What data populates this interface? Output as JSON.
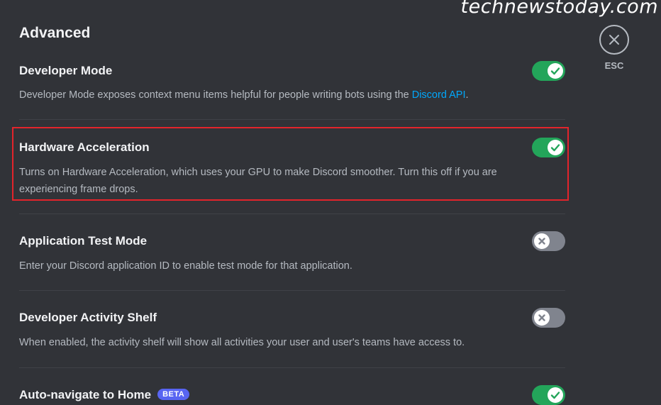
{
  "watermark": "technewstoday.com",
  "page_title": "Advanced",
  "esc": {
    "label": "ESC",
    "icon": "close-icon"
  },
  "settings": [
    {
      "title": "Developer Mode",
      "desc_before": "Developer Mode exposes context menu items helpful for people writing bots using the ",
      "desc_link": "Discord API",
      "desc_after": ".",
      "enabled": true
    },
    {
      "title": "Hardware Acceleration",
      "desc_line1": "Turns on Hardware Acceleration, which uses your GPU to make Discord smoother. Turn this off if you are",
      "desc_line2": "experiencing frame drops.",
      "enabled": true
    },
    {
      "title": "Application Test Mode",
      "desc": "Enter your Discord application ID to enable test mode for that application.",
      "enabled": false
    },
    {
      "title": "Developer Activity Shelf",
      "desc": "When enabled, the activity shelf will show all activities your user and user's teams have access to.",
      "enabled": false
    },
    {
      "title": "Auto-navigate to Home",
      "badge": "BETA",
      "enabled": true
    }
  ],
  "colors": {
    "toggle_on": "#23a55a",
    "toggle_off": "#80848e",
    "link": "#00a8fc",
    "highlight": "#e3242b",
    "badge": "#5865f2"
  }
}
